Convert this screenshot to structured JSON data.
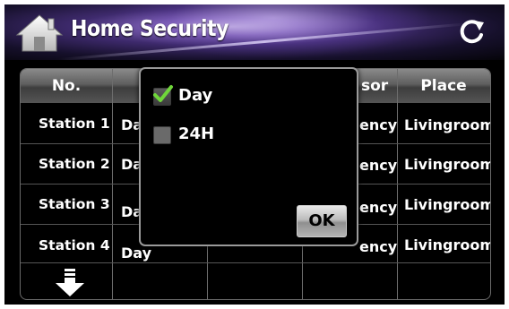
{
  "header": {
    "title": "Home Security",
    "home_icon": "home-icon",
    "refresh_icon": "refresh-icon"
  },
  "table": {
    "columns": [
      "No.",
      "",
      "",
      "sor",
      "Place"
    ],
    "rows": [
      {
        "no": "Station 1",
        "c2": "Da",
        "c3": "",
        "c4": "ency",
        "place": "Livingroom"
      },
      {
        "no": "Station 2",
        "c2": "Da",
        "c3": "",
        "c4": "ency",
        "place": "Livingroom"
      },
      {
        "no": "Station 3",
        "c2": "Da",
        "c3": "",
        "c4": "ency",
        "place": "Livingroom"
      },
      {
        "no": "Station 4",
        "c2": "Day",
        "c3": "",
        "c4": "ency",
        "place": "Livingroom"
      }
    ],
    "scroll_icon": "arrow-down-icon"
  },
  "popup": {
    "options": [
      {
        "label": "Day",
        "checked": true
      },
      {
        "label": "24H",
        "checked": false
      }
    ],
    "ok_label": "OK"
  },
  "colors": {
    "background": "#000000",
    "header_purple": "#3e2a6d",
    "check_green": "#6fd63a",
    "grid": "#6d6d6d"
  }
}
